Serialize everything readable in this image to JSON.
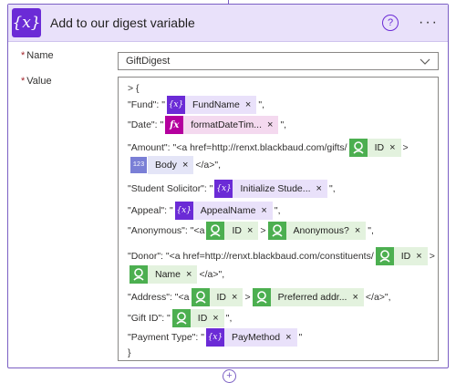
{
  "header": {
    "icon_glyph": "{x}",
    "title": "Add to our digest variable",
    "help_glyph": "?",
    "more_glyph": "···"
  },
  "fields": {
    "name_label": "Name",
    "name_required": "*",
    "name_value": "GiftDigest",
    "value_label": "Value",
    "value_required": "*"
  },
  "value": {
    "open": "> {",
    "close": "}",
    "rows": [
      {
        "pre": "\"Fund\": \"",
        "tokens": [
          {
            "kind": "var",
            "icon": "{x}",
            "label": "FundName"
          }
        ],
        "post": "\","
      },
      {
        "pre": "\"Date\": \"",
        "tokens": [
          {
            "kind": "fx",
            "icon": "fx",
            "label": "formatDateTim..."
          }
        ],
        "post": "\","
      },
      {
        "pre": "\"Amount\": \"<a href=http://renxt.blackbaud.com/gifts/",
        "tokens": [
          {
            "kind": "con",
            "label": "ID"
          }
        ],
        "post": ">"
      },
      {
        "pre": "",
        "tokens": [
          {
            "kind": "num",
            "icon": "123",
            "label": "Body"
          }
        ],
        "post": "</a>\","
      },
      {
        "pre": "\"Student Solicitor\": \"",
        "tokens": [
          {
            "kind": "var",
            "icon": "{x}",
            "label": "Initialize Stude..."
          }
        ],
        "post": "\","
      },
      {
        "pre": "\"Appeal\": \"",
        "tokens": [
          {
            "kind": "var",
            "icon": "{x}",
            "label": "AppealName"
          }
        ],
        "post": "\","
      },
      {
        "pre": "\"Anonymous\": \"<a",
        "tokens": [
          {
            "kind": "con",
            "label": "ID"
          },
          {
            "kind": "text",
            "label": ">"
          },
          {
            "kind": "con",
            "label": "Anonymous?"
          }
        ],
        "post": "\","
      },
      {
        "pre": "\"Donor\": \"<a href=http://renxt.blackbaud.com/constituents/",
        "tokens": [
          {
            "kind": "con",
            "label": "ID"
          }
        ],
        "post": ">"
      },
      {
        "pre": "",
        "tokens": [
          {
            "kind": "con",
            "label": "Name"
          }
        ],
        "post": "</a>\","
      },
      {
        "pre": "\"Address\": \"<a",
        "tokens": [
          {
            "kind": "con",
            "label": "ID"
          },
          {
            "kind": "text",
            "label": ">"
          },
          {
            "kind": "con",
            "label": "Preferred addr..."
          }
        ],
        "post": "</a>\","
      },
      {
        "pre": "\"Gift ID\": \"",
        "tokens": [
          {
            "kind": "con",
            "label": "ID"
          }
        ],
        "post": "\","
      },
      {
        "pre": "\"Payment Type\": \"",
        "tokens": [
          {
            "kind": "var",
            "icon": "{x}",
            "label": "PayMethod"
          }
        ],
        "post": "\""
      }
    ],
    "remove_glyph": "×"
  },
  "add_step_glyph": "+",
  "colors": {
    "accent": "#6b2bd6",
    "header_bg": "#e9e1fa",
    "connector": "#4caf50",
    "expression": "#b4009e"
  }
}
